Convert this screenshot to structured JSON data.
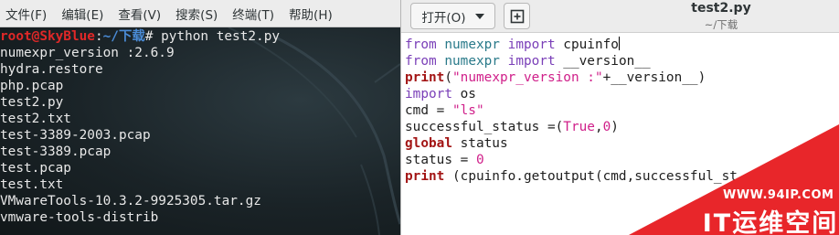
{
  "terminal": {
    "menu": [
      "文件(F)",
      "编辑(E)",
      "查看(V)",
      "搜索(S)",
      "终端(T)",
      "帮助(H)"
    ],
    "prompt": {
      "user_host": "root@SkyBlue",
      "sep": ":",
      "path": "~/下载",
      "symbol": "#",
      "command": " python test2.py"
    },
    "output": [
      "numexpr_version :2.6.9",
      "hydra.restore",
      "php.pcap",
      "test2.py",
      "test2.txt",
      "test-3389-2003.pcap",
      "test-3389.pcap",
      "test.pcap",
      "test.txt",
      "VMwareTools-10.3.2-9925305.tar.gz",
      "vmware-tools-distrib"
    ]
  },
  "editor": {
    "open_label": "打开(O)",
    "title": "test2.py",
    "subtitle": "~/下载",
    "code": {
      "l1": {
        "from": "from",
        "mod": "numexpr",
        "imp": "import",
        "name": " cpuinfo"
      },
      "l2": {
        "from": "from",
        "mod": "numexpr",
        "imp": "import",
        "name": " __version__"
      },
      "l3": {
        "print": "print",
        "open": "(",
        "str": "\"numexpr_version :\"",
        "rest": "+__version__)"
      },
      "l4": {
        "imp": "import",
        "name": " os"
      },
      "l5": {
        "lhs": "cmd = ",
        "str": "\"ls\""
      },
      "l6": {
        "lhs": "successful_status =(",
        "const": "True",
        "comma": ",",
        "num": "0",
        "close": ")"
      },
      "l7": {
        "kw": "global",
        "name": " status"
      },
      "l8": {
        "lhs": "status = ",
        "num": "0"
      },
      "l9": {
        "print": "print",
        "rest": " (cpuinfo.getoutput(cmd,successful_st"
      }
    }
  },
  "watermark": {
    "url": "WWW.94IP.COM",
    "brand": "IT运维空间",
    "color": "#e8262a"
  },
  "colors": {
    "terminal_bg": "#1b2428",
    "prompt_user": "#e02828",
    "prompt_path": "#4a8bd6"
  }
}
